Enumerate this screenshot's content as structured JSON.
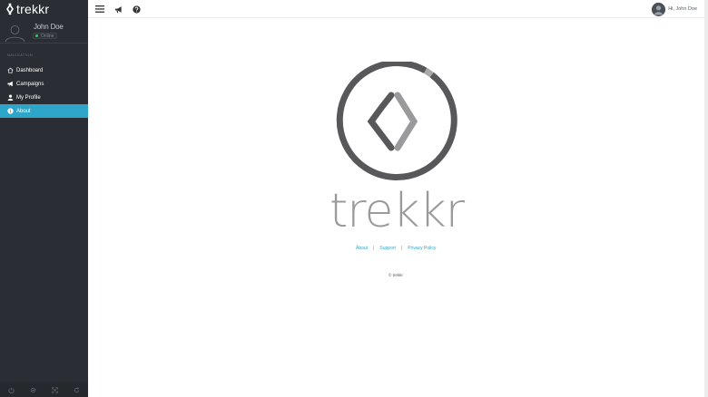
{
  "brand": {
    "name": "trekkr"
  },
  "user": {
    "name": "John Doe",
    "status": "Online",
    "greeting": "Hi, John Doe"
  },
  "nav": {
    "heading": "NAVIGATION",
    "items": [
      {
        "label": "Dashboard",
        "icon": "home-icon",
        "active": false
      },
      {
        "label": "Campaigns",
        "icon": "megaphone-icon",
        "active": false
      },
      {
        "label": "My Profile",
        "icon": "user-icon",
        "active": false
      },
      {
        "label": "About",
        "icon": "info-icon",
        "active": true
      }
    ]
  },
  "topbar": {
    "icons": [
      "menu-icon",
      "megaphone-icon",
      "help-icon"
    ]
  },
  "footer_icons": [
    "power-icon",
    "settings-icon",
    "fullscreen-icon",
    "refresh-icon"
  ],
  "main": {
    "logo_text": "trekkr",
    "links": [
      "About",
      "Support",
      "Privacy Policy"
    ],
    "separator": "|",
    "copyright": "© trekkr"
  },
  "colors": {
    "sidebar_bg": "#2a2d33",
    "accent": "#2ea6c9",
    "online": "#3bbf5c",
    "logo_dark": "#58585a",
    "logo_light": "#9a9a9c"
  }
}
